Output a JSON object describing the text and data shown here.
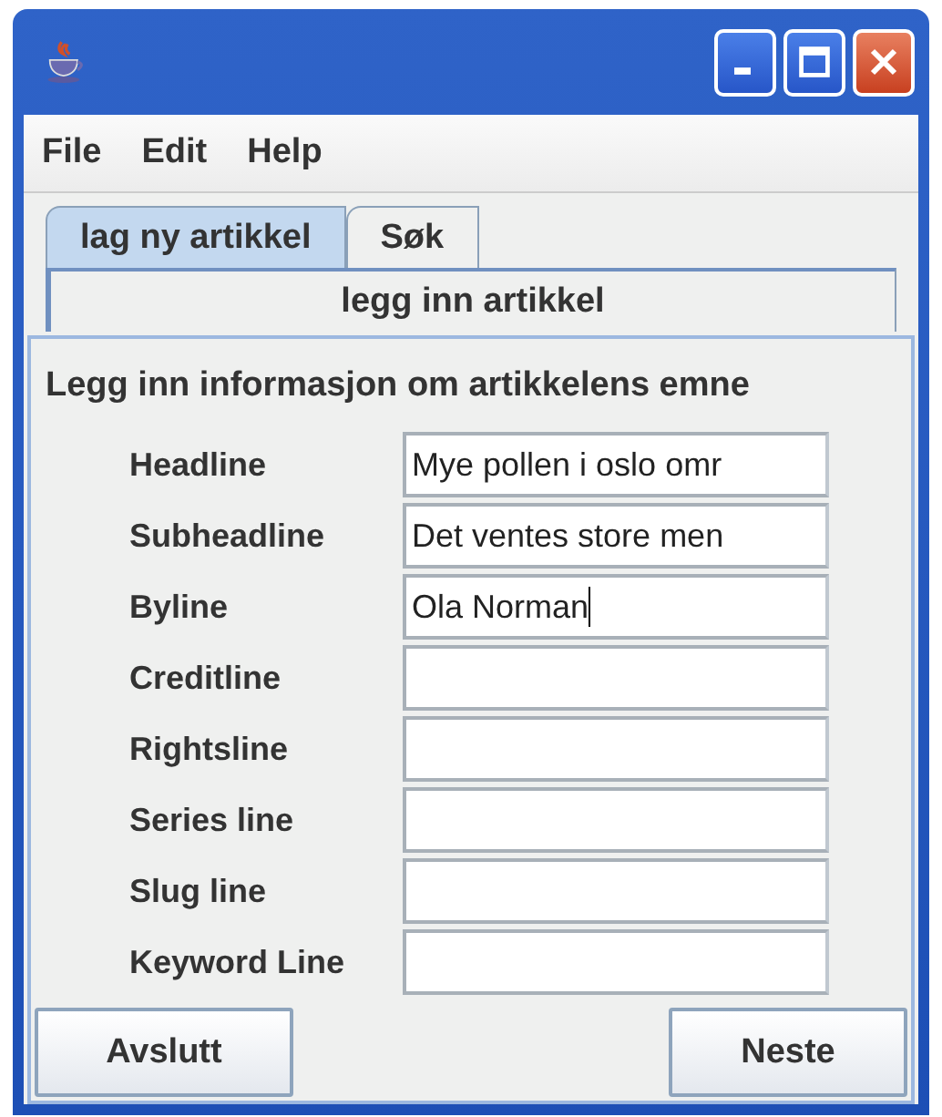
{
  "menu": [
    "File",
    "Edit",
    "Help"
  ],
  "tabs": [
    {
      "label": "lag ny artikkel",
      "selected": true
    },
    {
      "label": "Søk",
      "selected": false
    }
  ],
  "subtabs": [
    {
      "label": "legg inn artikkel",
      "selected": true
    }
  ],
  "heading": "Legg inn informasjon om artikkelens emne",
  "fields": [
    {
      "label": "Headline",
      "value": "Mye pollen i oslo omr",
      "focused": false
    },
    {
      "label": "Subheadline",
      "value": "Det ventes store men",
      "focused": false
    },
    {
      "label": "Byline",
      "value": "Ola Norman",
      "focused": true
    },
    {
      "label": "Creditline",
      "focused": false
    },
    {
      "label": "Rightsline",
      "focused": false
    },
    {
      "label": "Series line",
      "focused": false
    },
    {
      "label": "Slug line",
      "focused": false
    },
    {
      "label": "Keyword Line",
      "focused": false
    }
  ],
  "buttons": [
    "Avslutt",
    "Neste"
  ]
}
